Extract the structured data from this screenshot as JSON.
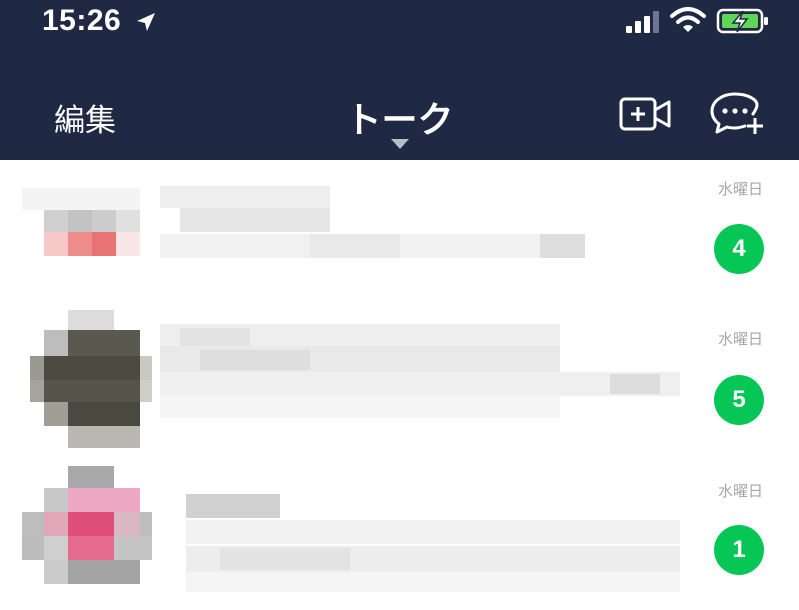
{
  "status_bar": {
    "time": "15:26",
    "icons": [
      "location-arrow-icon",
      "cellular-signal-icon",
      "wifi-icon",
      "battery-charging-icon"
    ],
    "battery_color": "#5dd65a"
  },
  "header": {
    "edit_label": "編集",
    "title": "トーク",
    "actions": [
      "video-call-add-icon",
      "new-chat-icon"
    ],
    "background": "#1f2944"
  },
  "chats": [
    {
      "date": "水曜日",
      "unread": "4"
    },
    {
      "date": "水曜日",
      "unread": "5"
    },
    {
      "date": "水曜日",
      "unread": "1"
    }
  ],
  "colors": {
    "badge": "#06c755",
    "date_text": "#a6a6a6"
  }
}
